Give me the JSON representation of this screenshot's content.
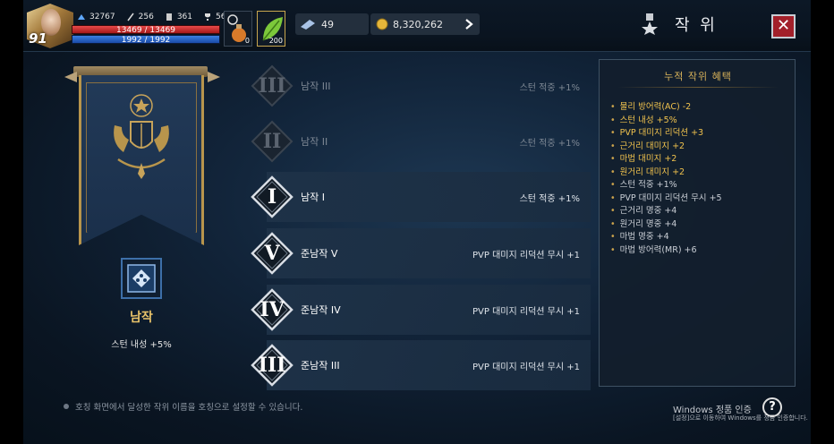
{
  "player": {
    "level": "91",
    "power": "32767",
    "stat1": "256",
    "stat2": "361",
    "stat3": "56",
    "hp": "13469 / 13469",
    "mp": "1992 / 1992"
  },
  "items": {
    "potion_count": "0",
    "herb_count": "200"
  },
  "currency": {
    "tickets": "49",
    "gold": "8,320,262"
  },
  "header": {
    "title": "작 위"
  },
  "current_rank": {
    "name": "남작",
    "effect": "스턴 내성 +5%"
  },
  "ranks": [
    {
      "numeral": "III",
      "label": "남작 III",
      "bonus": "스턴 적중 +1%"
    },
    {
      "numeral": "II",
      "label": "남작 II",
      "bonus": "스턴 적중 +1%"
    },
    {
      "numeral": "I",
      "label": "남작 I",
      "bonus": "스턴 적중 +1%"
    },
    {
      "numeral": "V",
      "label": "준남작 V",
      "bonus": "PVP 대미지 리덕션 무시 +1"
    },
    {
      "numeral": "IV",
      "label": "준남작 IV",
      "bonus": "PVP 대미지 리덕션 무시 +1"
    },
    {
      "numeral": "III",
      "label": "준남작 III",
      "bonus": "PVP 대미지 리덕션 무시 +1"
    }
  ],
  "benefits_panel": {
    "title": "누적 작위 혜택",
    "items": [
      "물리 방어력(AC) -2",
      "스턴 내성 +5%",
      "PVP 대미지 리덕션 +3",
      "근거리 대미지 +2",
      "마법 대미지 +2",
      "원거리 대미지 +2",
      "스턴 적중 +1%",
      "PVP 대미지 리덕션 무시 +5",
      "근거리 명중 +4",
      "원거리 명중 +4",
      "마법 명중 +4",
      "마법 방어력(MR) +6"
    ]
  },
  "footer": {
    "hint": "호칭 화면에서 달성한 작위 이름을 호칭으로 설정할 수 있습니다.",
    "watermark_title": "Windows 정품 인증",
    "watermark_sub": "[설정]으로 이동하여 Windows를 정품 인증합니다."
  },
  "colors": {
    "accent_gold": "#f0c24d",
    "close_red": "#a3202a",
    "hp_red": "#e84a4a",
    "mp_blue": "#3b7fe0"
  }
}
